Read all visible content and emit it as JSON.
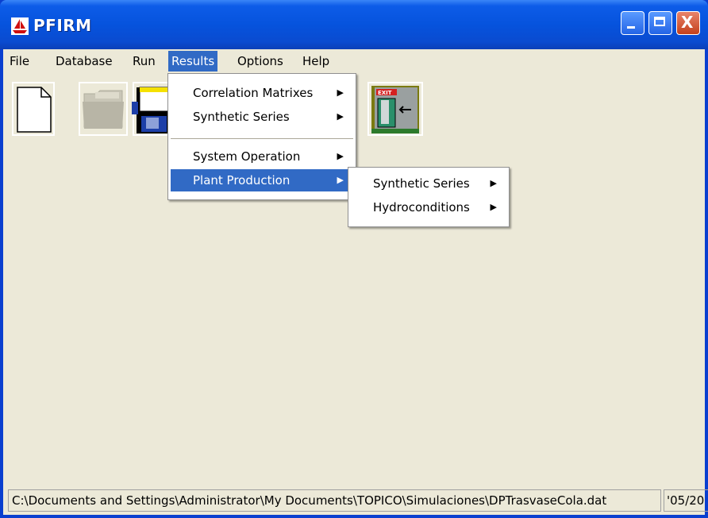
{
  "window": {
    "title": "PFIRM",
    "close_glyph": "X"
  },
  "menubar": {
    "items": [
      {
        "label": "File"
      },
      {
        "label": "Database"
      },
      {
        "label": "Run"
      },
      {
        "label": "Results",
        "active": true
      },
      {
        "label": "Options"
      },
      {
        "label": "Help"
      }
    ]
  },
  "toolbar": {
    "buttons": [
      {
        "icon": "new-document-icon",
        "enabled": true
      },
      {
        "icon": "open-folder-icon",
        "enabled": false
      },
      {
        "icon": "save-floppy-icon",
        "enabled": true
      },
      {
        "icon": "exit-door-icon",
        "label": "EXIT",
        "enabled": true
      }
    ]
  },
  "results_menu": {
    "items": [
      {
        "label": "Correlation Matrixes",
        "submenu": true
      },
      {
        "label": "Synthetic Series",
        "submenu": true
      },
      {
        "label": "System Operation",
        "submenu": true
      },
      {
        "label": "Plant Production",
        "submenu": true,
        "highlighted": true
      }
    ]
  },
  "plant_production_submenu": {
    "items": [
      {
        "label": "Synthetic Series",
        "submenu": true
      },
      {
        "label": "Hydroconditions",
        "submenu": true
      }
    ]
  },
  "submenu_arrow": "▶",
  "statusbar": {
    "path": "C:\\Documents and Settings\\Administrator\\My Documents\\TOPICO\\Simulaciones\\DPTrasvaseCola.dat",
    "date": "'05/20"
  },
  "colors": {
    "titlebar": "#0653dd",
    "menu_highlight": "#316ac5",
    "client_background": "#ece9d8",
    "close_button": "#c4401b"
  }
}
